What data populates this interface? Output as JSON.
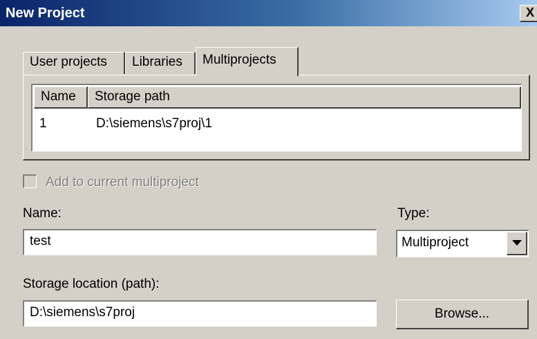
{
  "window": {
    "title": "New Project",
    "close_glyph": "X"
  },
  "tabs": [
    {
      "label": "User projects"
    },
    {
      "label": "Libraries"
    },
    {
      "label": "Multiprojects"
    }
  ],
  "list": {
    "columns": [
      "Name",
      "Storage path"
    ],
    "rows": [
      {
        "name": "1",
        "path": "D:\\siemens\\s7proj\\1"
      }
    ]
  },
  "add_to_multiproject": {
    "label": "Add to current multiproject",
    "checked": false,
    "enabled": false
  },
  "name_field": {
    "label": "Name:",
    "value": "test"
  },
  "type_field": {
    "label": "Type:",
    "value": "Multiproject"
  },
  "storage_field": {
    "label": "Storage location (path):",
    "value": "D:\\siemens\\s7proj"
  },
  "browse_button": {
    "label": "Browse..."
  },
  "colors": {
    "face": "#d4d0c8",
    "title_start": "#0a246a",
    "title_end": "#a6caf0"
  }
}
